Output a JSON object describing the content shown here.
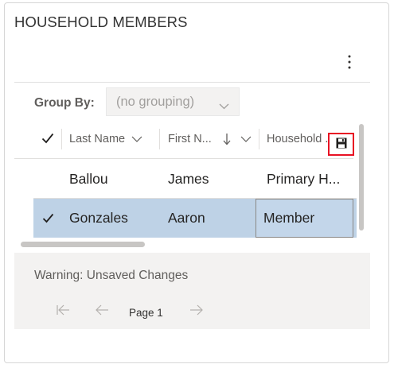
{
  "card": {
    "title": "HOUSEHOLD MEMBERS"
  },
  "toolbar": {
    "more_icon": "more-vertical-icon"
  },
  "group_by": {
    "label": "Group By:",
    "selected": "(no grouping)"
  },
  "grid": {
    "columns": [
      {
        "label": "Last Name",
        "indicator": "chevron-down-icon"
      },
      {
        "label": "First N...",
        "indicator": "sort-descending-arrow-icon"
      },
      {
        "label": "Household ..."
      }
    ],
    "save_icon": "save-icon",
    "rows": [
      {
        "selected": false,
        "last_name": "Ballou",
        "first_name": "James",
        "household": "Primary H..."
      },
      {
        "selected": true,
        "last_name": "Gonzales",
        "first_name": "Aaron",
        "household": "Member"
      }
    ]
  },
  "footer": {
    "warning": "Warning: Unsaved Changes",
    "page_label": "Page 1"
  },
  "colors": {
    "selected_row": "#bed2e6",
    "save_highlight": "#e81123",
    "footer_bg": "#f3f2f1"
  }
}
